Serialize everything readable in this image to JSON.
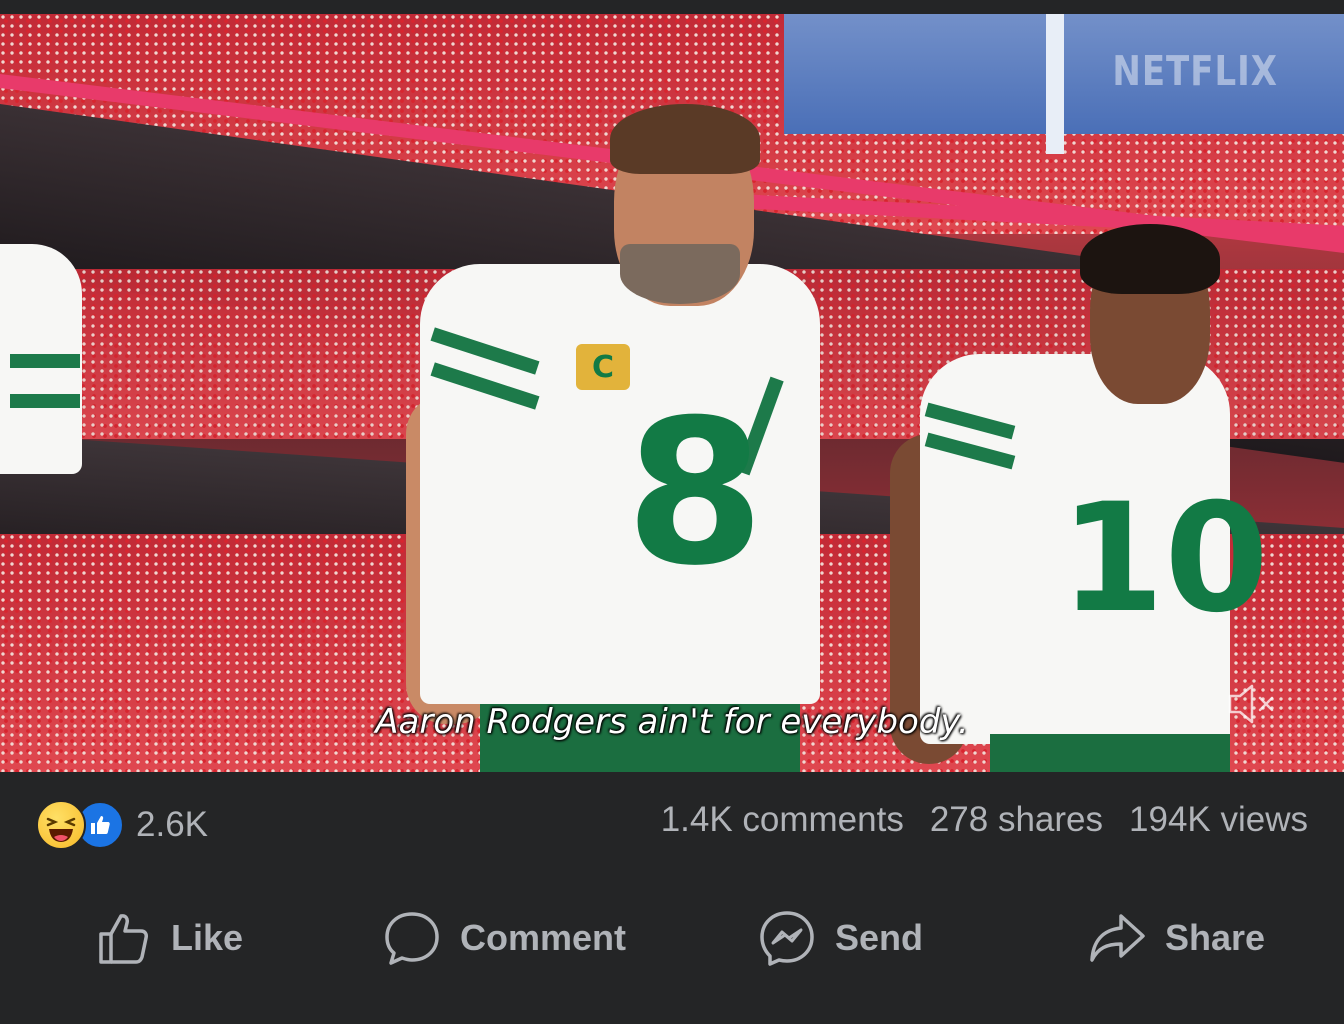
{
  "video": {
    "watermark": "NETFLIX",
    "subtitle": "Aaron Rodgers ain't for everybody.",
    "player_left_number": "8",
    "player_right_number": "10",
    "captain_patch": "C",
    "mute_icon": "speaker-muted-icon"
  },
  "stats": {
    "reaction_icons": [
      "haha-reaction-icon",
      "like-reaction-icon"
    ],
    "reaction_count": "2.6K",
    "comments": "1.4K comments",
    "shares": "278 shares",
    "views": "194K views"
  },
  "actions": [
    {
      "label": "Like",
      "icon": "thumbs-up-icon"
    },
    {
      "label": "Comment",
      "icon": "speech-bubble-icon"
    },
    {
      "label": "Send",
      "icon": "messenger-icon"
    },
    {
      "label": "Share",
      "icon": "share-arrow-icon"
    }
  ],
  "colors": {
    "background": "#242526",
    "secondary_text": "#b0b3b8",
    "like_blue": "#1b74e4",
    "haha_yellow": "#f7b928",
    "jersey_green": "#127a45"
  }
}
